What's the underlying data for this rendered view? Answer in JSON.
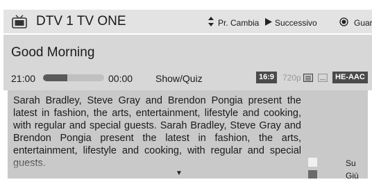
{
  "header": {
    "channel": "DTV 1 TV ONE",
    "hints": {
      "change": "Pr. Cambia",
      "next": "Successivo",
      "watch": "Guarda"
    }
  },
  "program": {
    "title": "Good Morning",
    "start_time": "21:00",
    "end_time": "00:00",
    "progress_fraction": 0.4,
    "genre": "Show/Quiz",
    "aspect_badge": "16:9",
    "resolution": "720p",
    "audio_badge": "HE-AAC"
  },
  "description": "Sarah Bradley, Steve Gray and Brendon Pongia present the latest in fashion, the arts, entertainment, lifestyle and cooking, with regular and special guests. Sarah Bradley, Steve Gray and Brendon Pongia present the latest in fashion, the arts, entertainment, lifestyle and cooking, with regular and special guests.",
  "scroll": {
    "up_label": "Su",
    "down_label": "Giù"
  },
  "icons": {
    "channel": "tv-icon",
    "change": "up-down-arrow-icon",
    "next": "play-icon",
    "watch": "ok-button-icon",
    "teletext": "teletext-icon",
    "subtitle": "subtitle-icon",
    "more": "down-arrow-icon"
  },
  "colors": {
    "header_bg": "#e3e3e3",
    "info_band_bg": "#d7d7d7",
    "description_bg": "#c9c9c9",
    "badge_bg": "#4a4a4a",
    "progress_fill": "#5a5a5a"
  }
}
